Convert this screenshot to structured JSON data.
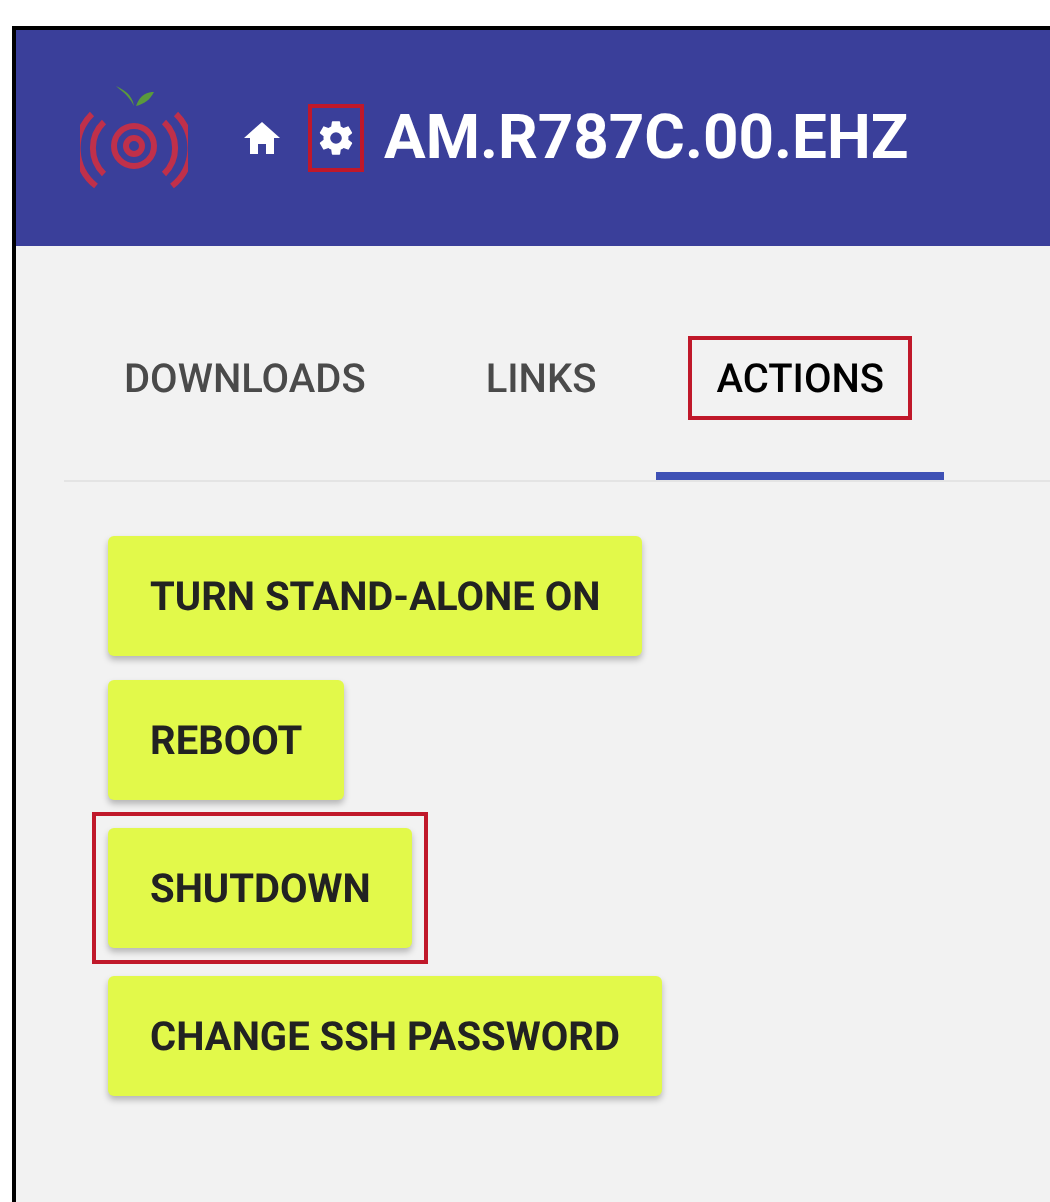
{
  "header": {
    "title": "AM.R787C.00.EHZ",
    "settings_highlighted": true
  },
  "tabs": [
    {
      "label": "DOWNLOADS",
      "selected": false,
      "highlighted": false
    },
    {
      "label": "LINKS",
      "selected": false,
      "highlighted": false
    },
    {
      "label": "ACTIONS",
      "selected": true,
      "highlighted": true
    }
  ],
  "actions": [
    {
      "label": "TURN STAND-ALONE ON",
      "highlighted": false
    },
    {
      "label": "REBOOT",
      "highlighted": false
    },
    {
      "label": "SHUTDOWN",
      "highlighted": true
    },
    {
      "label": "CHANGE SSH PASSWORD",
      "highlighted": false
    }
  ]
}
